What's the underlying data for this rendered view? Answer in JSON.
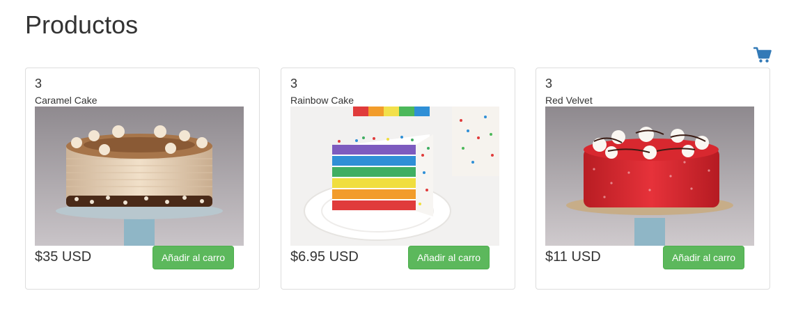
{
  "page": {
    "title": "Productos"
  },
  "cart": {
    "icon": "shopping-cart-icon",
    "color": "#337ab7"
  },
  "button_color": "#5cb85c",
  "products": [
    {
      "stock": "3",
      "name": "Caramel Cake",
      "price": "$35 USD",
      "button_label": "Añadir al carro",
      "image": "caramel-cake-photo"
    },
    {
      "stock": "3",
      "name": "Rainbow Cake",
      "price": "$6.95 USD",
      "button_label": "Añadir al carro",
      "image": "rainbow-cake-slice-photo"
    },
    {
      "stock": "3",
      "name": "Red Velvet",
      "price": "$11 USD",
      "button_label": "Añadir al carro",
      "image": "red-velvet-cake-photo"
    }
  ]
}
